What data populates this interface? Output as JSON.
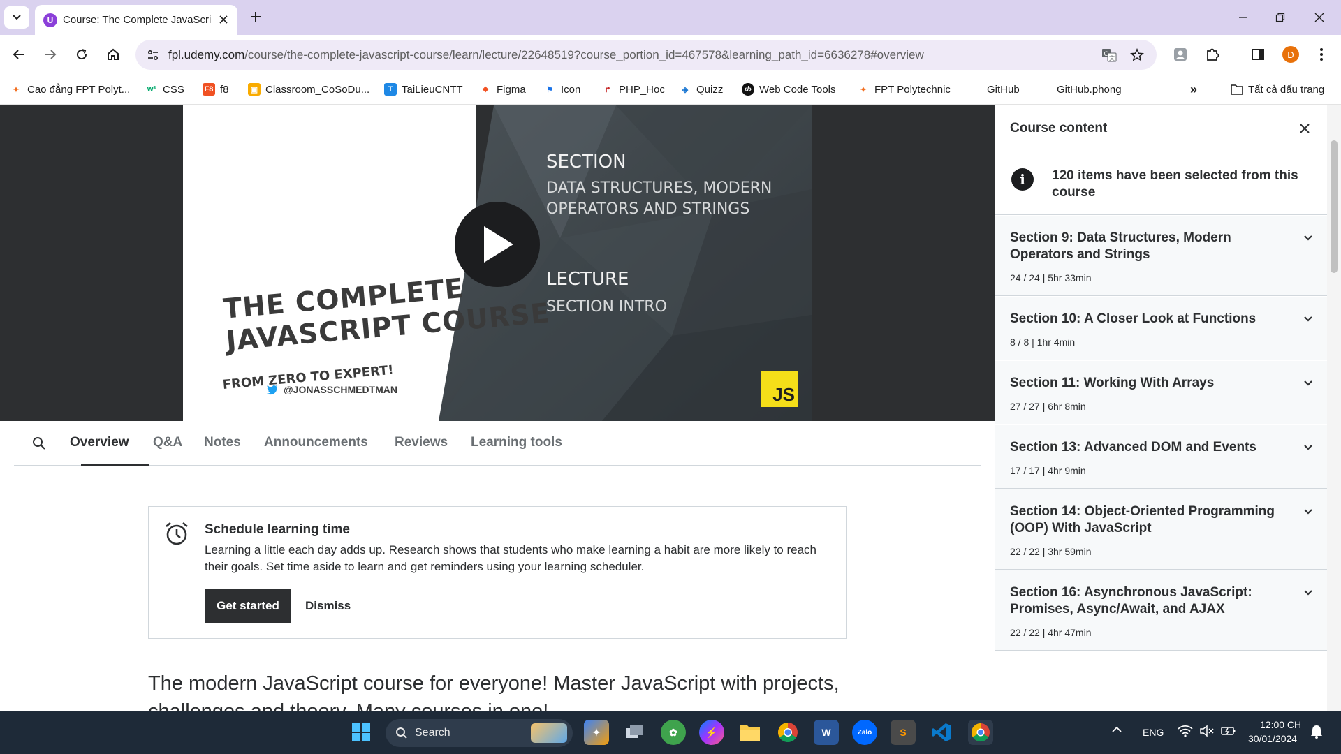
{
  "browser": {
    "tab_title": "Course: The Complete JavaScript Course",
    "url_domain": "fpl.udemy.com",
    "url_path": "/course/the-complete-javascript-course/learn/lecture/22648519?course_portion_id=467578&learning_path_id=6636278#overview",
    "profile_initial": "D"
  },
  "bookmarks": [
    {
      "label": "Cao đẳng FPT Polyt...",
      "icon": "fpt-logo-icon",
      "color": "#f26f21"
    },
    {
      "label": "CSS",
      "icon": "w3-icon",
      "color": "#04aa6d"
    },
    {
      "label": "f8",
      "icon": "f8-icon",
      "color": "#f05123"
    },
    {
      "label": "Classroom_CoSoDu...",
      "icon": "classroom-icon",
      "color": "#f9ab00"
    },
    {
      "label": "TaiLieuCNTT",
      "icon": "tailieu-icon",
      "color": "#1e88e5"
    },
    {
      "label": "Figma",
      "icon": "figma-icon",
      "color": "#f24e1e"
    },
    {
      "label": "Icon",
      "icon": "flag-icon",
      "color": "#1a73e8"
    },
    {
      "label": "PHP_Hoc",
      "icon": "php-icon",
      "color": "#c62828"
    },
    {
      "label": "Quizz",
      "icon": "quizz-icon",
      "color": "#1976d2"
    },
    {
      "label": "Web Code Tools",
      "icon": "code-tools-icon",
      "color": "#111111"
    },
    {
      "label": "FPT Polytechnic",
      "icon": "fpt-logo-icon",
      "color": "#f26f21"
    },
    {
      "label": "GitHub",
      "icon": "",
      "color": ""
    },
    {
      "label": "GitHub.phong",
      "icon": "",
      "color": ""
    }
  ],
  "bookmarks_all": "Tất cả dấu trang",
  "video": {
    "title_line1": "THE COMPLETE",
    "title_line2": "JAVASCRIPT COURSE",
    "subtitle": "FROM ZERO TO EXPERT!",
    "twitter": "@JONASSCHMEDTMAN",
    "section_label": "SECTION",
    "section_name_1": "DATA STRUCTURES, MODERN",
    "section_name_2": "OPERATORS AND STRINGS",
    "lecture_label": "LECTURE",
    "lecture_name": "SECTION INTRO",
    "js_badge": "JS"
  },
  "tabs": [
    "Overview",
    "Q&A",
    "Notes",
    "Announcements",
    "Reviews",
    "Learning tools"
  ],
  "schedule": {
    "title": "Schedule learning time",
    "text": "Learning a little each day adds up. Research shows that students who make learning a habit are more likely to reach their goals. Set time aside to learn and get reminders using your learning scheduler.",
    "primary": "Get started",
    "secondary": "Dismiss"
  },
  "headline": "The modern JavaScript course for everyone! Master JavaScript with projects, challenges and theory. Many courses in one!",
  "sidebar": {
    "title": "Course content",
    "info": "120 items have been selected from this course",
    "sections": [
      {
        "name": "Section 9: Data Structures, Modern Operators and Strings",
        "meta": "24 / 24 | 5hr 33min"
      },
      {
        "name": "Section 10: A Closer Look at Functions",
        "meta": "8 / 8 | 1hr 4min"
      },
      {
        "name": "Section 11: Working With Arrays",
        "meta": "27 / 27 | 6hr 8min"
      },
      {
        "name": "Section 13: Advanced DOM and Events",
        "meta": "17 / 17 | 4hr 9min"
      },
      {
        "name": "Section 14: Object-Oriented Programming (OOP) With JavaScript",
        "meta": "22 / 22 | 3hr 59min"
      },
      {
        "name": "Section 16: Asynchronous JavaScript: Promises, Async/Await, and AJAX",
        "meta": "22 / 22 | 4hr 47min"
      }
    ]
  },
  "taskbar": {
    "search": "Search",
    "lang": "ENG",
    "time": "12:00 CH",
    "date": "30/01/2024"
  }
}
